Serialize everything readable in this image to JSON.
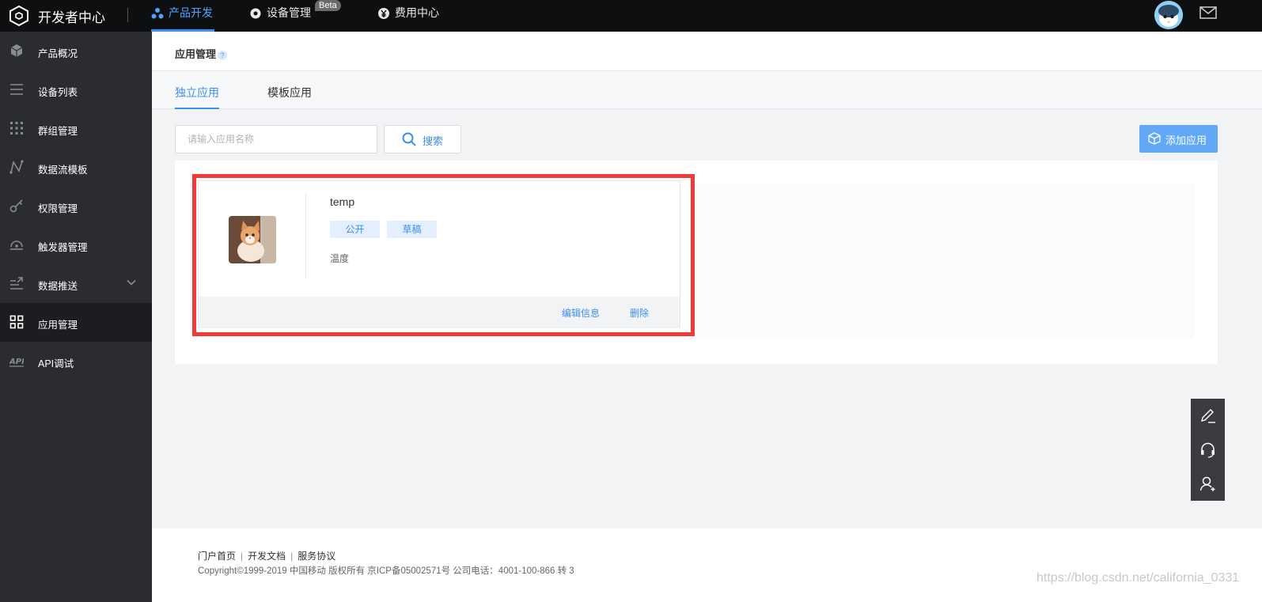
{
  "topbar": {
    "brand": "开发者中心",
    "nav": [
      {
        "label": "产品开发",
        "icon": "cluster-icon",
        "active": true
      },
      {
        "label": "设备管理",
        "icon": "device-icon",
        "active": false,
        "badge": "Beta"
      },
      {
        "label": "费用中心",
        "icon": "yen-icon",
        "active": false
      }
    ],
    "avatar_icon": "avatar-icon",
    "mail_icon": "mail-icon"
  },
  "sidebar": {
    "items": [
      {
        "label": "产品概况",
        "icon": "cube-icon"
      },
      {
        "label": "设备列表",
        "icon": "list-icon"
      },
      {
        "label": "群组管理",
        "icon": "dots-grid-icon"
      },
      {
        "label": "数据流模板",
        "icon": "flow-icon"
      },
      {
        "label": "权限管理",
        "icon": "key-icon"
      },
      {
        "label": "触发器管理",
        "icon": "trigger-icon"
      },
      {
        "label": "数据推送",
        "icon": "push-icon",
        "expandable": true
      },
      {
        "label": "应用管理",
        "icon": "apps-icon",
        "active": true
      },
      {
        "label": "API调试",
        "icon": "api-icon"
      }
    ]
  },
  "page": {
    "title": "应用管理",
    "help": "?",
    "tabs": [
      {
        "label": "独立应用",
        "active": true
      },
      {
        "label": "模板应用",
        "active": false
      }
    ]
  },
  "toolbar": {
    "search_placeholder": "请输入应用名称",
    "search_label": "搜索",
    "add_label": "添加应用"
  },
  "apps": [
    {
      "name": "temp",
      "tags": [
        "公开",
        "草稿"
      ],
      "description": "温度",
      "actions": [
        "编辑信息",
        "删除"
      ]
    }
  ],
  "footer": {
    "links": [
      "门户首页",
      "开发文档",
      "服务协议"
    ],
    "separator": "|",
    "copyright": "Copyright©1999-2019 中国移动 版权所有 京ICP备05002571号 公司电话：4001-100-866 转 3"
  },
  "watermark": "https://blog.csdn.net/california_0331",
  "float_bar": [
    "edit-icon",
    "headset-icon",
    "add-user-icon"
  ],
  "colors": {
    "accent": "#3b8ff0",
    "topbar_bg": "#0e0f11",
    "sidebar_bg": "#2b2c30",
    "highlight": "#f03a3a"
  }
}
